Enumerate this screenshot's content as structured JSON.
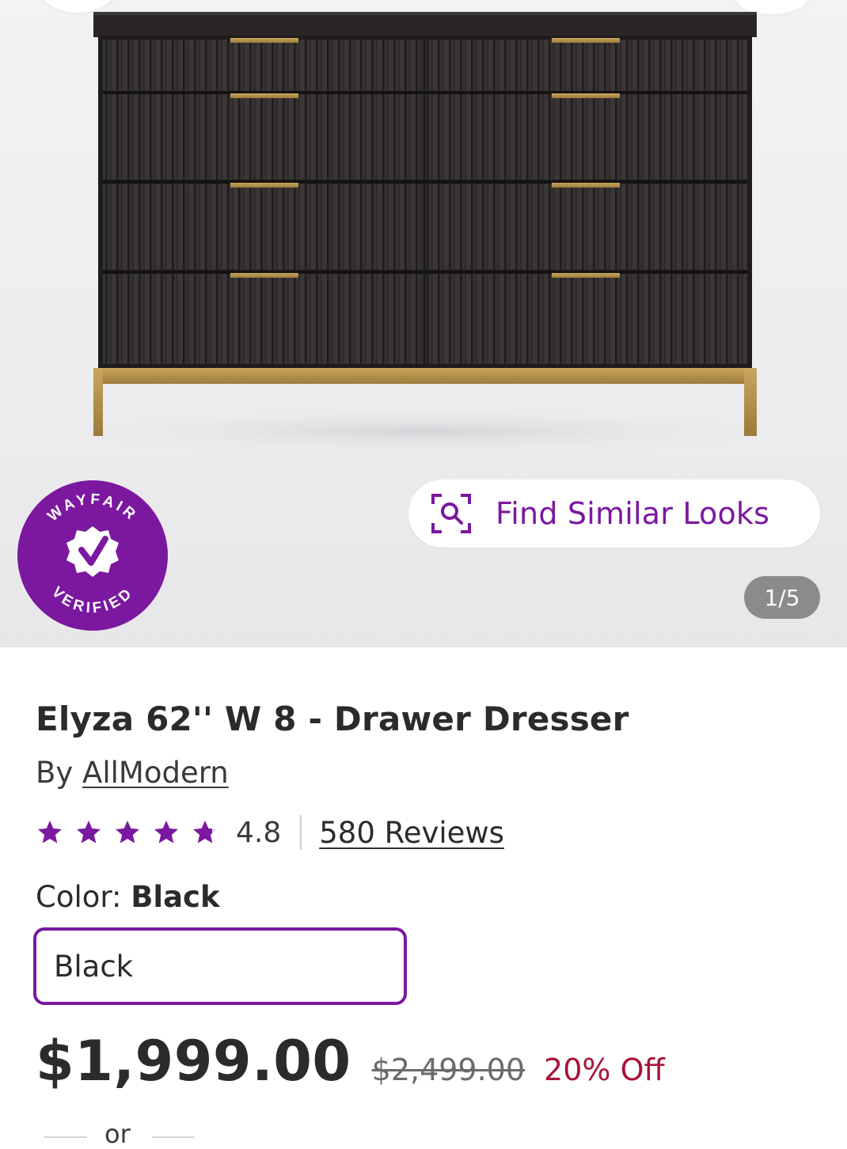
{
  "gallery": {
    "badge_text": "WAYFAIR VERIFIED",
    "find_similar_label": "Find Similar Looks",
    "pager": "1/5",
    "icons": {
      "find_similar": "visual-search-icon",
      "badge": "checkmark-seal-icon"
    }
  },
  "product": {
    "title": "Elyza 62'' W 8 - Drawer Dresser",
    "by_prefix": "By",
    "brand": "AllModern",
    "rating": {
      "value": "4.8",
      "stars_max": 5,
      "stars_filled": 4.8,
      "reviews_label": "580 Reviews"
    },
    "color": {
      "label": "Color:",
      "selected": "Black",
      "swatch_label": "Black"
    },
    "pricing": {
      "price": "$1,999.00",
      "was_price": "$2,499.00",
      "discount": "20% Off"
    },
    "or_text": "or"
  },
  "colors": {
    "accent": "#7b189f",
    "discount": "#a6143a",
    "text": "#2b2b2b"
  }
}
